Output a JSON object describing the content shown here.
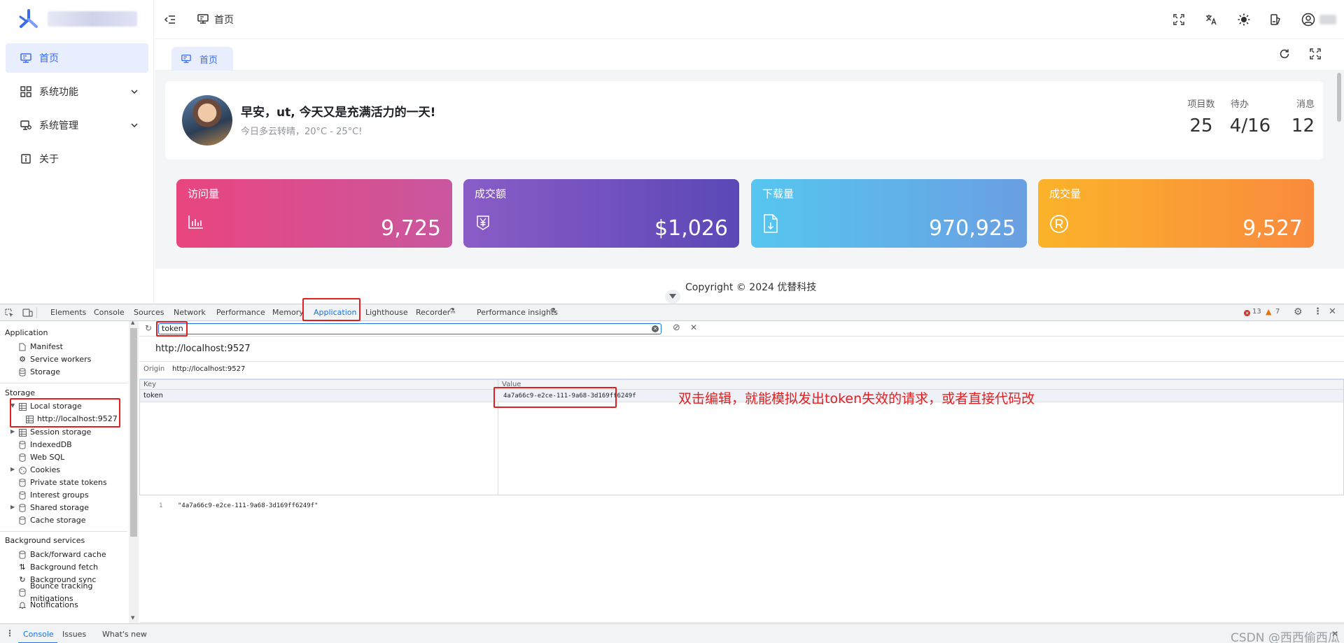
{
  "sidebar": {
    "logo_alt": "logo",
    "items": [
      {
        "label": "首页",
        "icon": "monitor-icon",
        "active": true
      },
      {
        "label": "系统功能",
        "icon": "grid-icon",
        "expandable": true
      },
      {
        "label": "系统管理",
        "icon": "settings-monitor-icon",
        "expandable": true
      },
      {
        "label": "关于",
        "icon": "info-icon"
      }
    ]
  },
  "header": {
    "breadcrumb": "首页",
    "icons": [
      "fullscreen-icon",
      "translate-icon",
      "sun-icon",
      "theme-icon",
      "user-icon"
    ]
  },
  "tabs": {
    "active_tab": "首页"
  },
  "welcome": {
    "greeting": "早安，ut, 今天又是充满活力的一天!",
    "weather": "今日多云转晴，20°C - 25°C!",
    "stats": [
      {
        "label": "项目数",
        "value": "25"
      },
      {
        "label": "待办",
        "value": "4/16"
      },
      {
        "label": "消息",
        "value": "12"
      }
    ]
  },
  "cards": [
    {
      "title": "访问量",
      "value": "9,725",
      "icon": "bar-chart-icon",
      "colors": [
        "#e9457f",
        "#c9579f"
      ]
    },
    {
      "title": "成交额",
      "value": "$1,026",
      "icon": "yen-icon",
      "colors": [
        "#8a5cc7",
        "#5b48b6"
      ]
    },
    {
      "title": "下载量",
      "value": "970,925",
      "icon": "download-file-icon",
      "colors": [
        "#56c6f0",
        "#6a9fe2"
      ]
    },
    {
      "title": "成交量",
      "value": "9,527",
      "icon": "registered-icon",
      "colors": [
        "#fbb32a",
        "#f98a3e"
      ]
    }
  ],
  "footer": {
    "copyright": "Copyright © 2024 优替科技"
  },
  "devtools": {
    "tabs": [
      "Elements",
      "Console",
      "Sources",
      "Network",
      "Performance",
      "Memory",
      "Application",
      "Lighthouse",
      "Recorder",
      "Performance insights"
    ],
    "active_tab": "Application",
    "errors": "13",
    "warnings": "7",
    "filter_value": "token",
    "origin_title": "http://localhost:9527",
    "origin_label": "Origin",
    "origin_value": "http://localhost:9527",
    "columns": [
      "Key",
      "Value"
    ],
    "rows": [
      {
        "key": "token",
        "value": "4a7a66c9-e2ce-111-9a68-3d169ff6249f"
      }
    ],
    "preview_line_no": "1",
    "preview_value": "\"4a7a66c9-e2ce-111-9a68-3d169ff6249f\"",
    "annotation": "双击编辑，就能模拟发出token失效的请求，或者直接代码改",
    "sidebar": {
      "sections": [
        {
          "title": "Application",
          "items": [
            "Manifest",
            "Service workers",
            "Storage"
          ]
        },
        {
          "title": "Storage",
          "items": [
            "Local storage",
            "http://localhost:9527",
            "Session storage",
            "IndexedDB",
            "Web SQL",
            "Cookies",
            "Private state tokens",
            "Interest groups",
            "Shared storage",
            "Cache storage"
          ]
        },
        {
          "title": "Background services",
          "items": [
            "Back/forward cache",
            "Background fetch",
            "Background sync",
            "Bounce tracking mitigations",
            "Notifications"
          ]
        }
      ]
    },
    "drawer_tabs": [
      "Console",
      "Issues",
      "What's new"
    ],
    "watermark": "CSDN @西西偷西瓜"
  }
}
